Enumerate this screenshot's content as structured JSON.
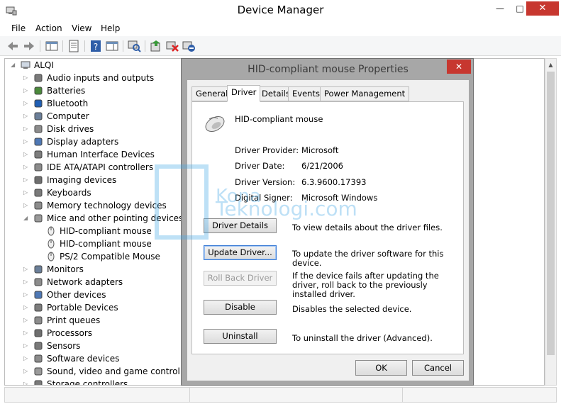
{
  "window": {
    "title": "Device Manager",
    "min_glyph": "—",
    "max_glyph": "□",
    "close_glyph": "✕"
  },
  "menu": [
    "File",
    "Action",
    "View",
    "Help"
  ],
  "tree": {
    "root": "ALQI",
    "categories": [
      "Audio inputs and outputs",
      "Batteries",
      "Bluetooth",
      "Computer",
      "Disk drives",
      "Display adapters",
      "Human Interface Devices",
      "IDE ATA/ATAPI controllers",
      "Imaging devices",
      "Keyboards",
      "Memory technology devices",
      "Mice and other pointing devices"
    ],
    "mice_children": [
      "HID-compliant mouse",
      "HID-compliant mouse",
      "PS/2 Compatible Mouse"
    ],
    "categories_after": [
      "Monitors",
      "Network adapters",
      "Other devices",
      "Portable Devices",
      "Print queues",
      "Processors",
      "Sensors",
      "Software devices",
      "Sound, video and game controllers",
      "Storage controllers"
    ]
  },
  "dialog": {
    "title": "HID-compliant mouse Properties",
    "close_glyph": "✕",
    "tabs": [
      "General",
      "Driver",
      "Details",
      "Events",
      "Power Management"
    ],
    "active_tab": "Driver",
    "device_name": "HID-compliant mouse",
    "fields": [
      {
        "key": "Driver Provider:",
        "value": "Microsoft"
      },
      {
        "key": "Driver Date:",
        "value": "6/21/2006"
      },
      {
        "key": "Driver Version:",
        "value": "6.3.9600.17393"
      },
      {
        "key": "Digital Signer:",
        "value": "Microsoft Windows"
      }
    ],
    "actions": [
      {
        "label": "Driver Details",
        "desc": "To view details about the driver files."
      },
      {
        "label": "Update Driver...",
        "desc": "To update the driver software for this device."
      },
      {
        "label": "Roll Back Driver",
        "desc": "If the device fails after updating the driver, roll back to the previously installed driver."
      },
      {
        "label": "Disable",
        "desc": "Disables the selected device."
      },
      {
        "label": "Uninstall",
        "desc": "To uninstall the driver (Advanced)."
      }
    ],
    "ok_label": "OK",
    "cancel_label": "Cancel"
  },
  "watermark": {
    "line1": "Kona",
    "line2": "Teknologi.com"
  },
  "colors": {
    "close_red": "#c7372f",
    "watermark_blue": "#46a8e6"
  }
}
